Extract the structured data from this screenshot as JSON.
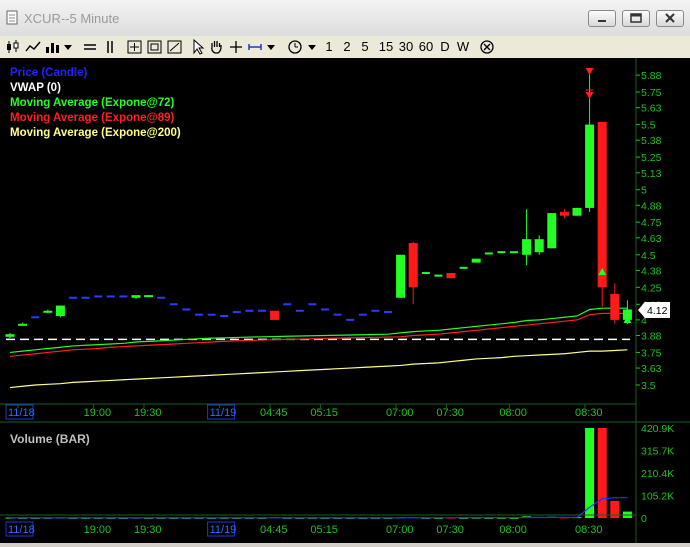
{
  "window": {
    "title": "XCUR--5 Minute"
  },
  "toolbar": {
    "periods": [
      "1",
      "2",
      "5",
      "15",
      "30",
      "60",
      "D",
      "W"
    ]
  },
  "price_panel": {
    "legend": [
      {
        "label": "Price (Candle)",
        "color": "#2222ff"
      },
      {
        "label": "VWAP (0)",
        "color": "#ffffff"
      },
      {
        "label": "Moving Average (Expone@72)",
        "color": "#22ff22"
      },
      {
        "label": "Moving Average (Expone@89)",
        "color": "#ff2020"
      },
      {
        "label": "Moving Average (Expone@200)",
        "color": "#ffff88"
      }
    ],
    "y_ticks": [
      "5.88",
      "5.75",
      "5.63",
      "5.5",
      "5.38",
      "5.25",
      "5.13",
      "5",
      "4.88",
      "4.75",
      "4.63",
      "4.5",
      "4.38",
      "4.25",
      "4.12",
      "4",
      "3.88",
      "3.75",
      "3.63",
      "3.5"
    ],
    "last_price": "4.12"
  },
  "volume_panel": {
    "title": "Volume (BAR)",
    "y_ticks": [
      "420.9K",
      "315.7K",
      "210.4K",
      "105.2K",
      "0"
    ]
  },
  "x_axis": {
    "labels": [
      "11/18",
      "19:00",
      "19:30",
      "11/19",
      "04:45",
      "05:15",
      "07:00",
      "07:30",
      "08:00",
      "08:30"
    ]
  },
  "chart_data": {
    "type": "candlestick",
    "y_range": [
      3.4,
      5.95
    ],
    "volume_range": [
      0,
      420900
    ],
    "candles": [
      {
        "o": 3.87,
        "h": 3.9,
        "l": 3.86,
        "c": 3.89,
        "v": 2000
      },
      {
        "o": 3.97,
        "h": 3.98,
        "l": 3.96,
        "c": 3.97,
        "v": 1000
      },
      {
        "o": 4.02,
        "h": 4.02,
        "l": 4.02,
        "c": 4.02,
        "v": 1000
      },
      {
        "o": 4.06,
        "h": 4.08,
        "l": 4.05,
        "c": 4.07,
        "v": 1500
      },
      {
        "o": 4.03,
        "h": 4.11,
        "l": 4.02,
        "c": 4.11,
        "v": 3000
      },
      {
        "o": 4.17,
        "h": 4.17,
        "l": 4.17,
        "c": 4.17,
        "v": 1000
      },
      {
        "o": 4.17,
        "h": 4.17,
        "l": 4.17,
        "c": 4.17,
        "v": 1000
      },
      {
        "o": 4.18,
        "h": 4.18,
        "l": 4.18,
        "c": 4.18,
        "v": 1000
      },
      {
        "o": 4.18,
        "h": 4.18,
        "l": 4.18,
        "c": 4.18,
        "v": 1000
      },
      {
        "o": 4.18,
        "h": 4.18,
        "l": 4.18,
        "c": 4.18,
        "v": 1000
      },
      {
        "o": 4.17,
        "h": 4.19,
        "l": 4.16,
        "c": 4.19,
        "v": 2000
      },
      {
        "o": 4.18,
        "h": 4.19,
        "l": 4.18,
        "c": 4.19,
        "v": 1000
      },
      {
        "o": 4.17,
        "h": 4.17,
        "l": 4.17,
        "c": 4.17,
        "v": 1000
      },
      {
        "o": 4.12,
        "h": 4.12,
        "l": 4.12,
        "c": 4.12,
        "v": 1000
      },
      {
        "o": 4.08,
        "h": 4.08,
        "l": 4.08,
        "c": 4.08,
        "v": 1000
      },
      {
        "o": 4.04,
        "h": 4.04,
        "l": 4.04,
        "c": 4.04,
        "v": 1000
      },
      {
        "o": 4.04,
        "h": 4.04,
        "l": 4.04,
        "c": 4.04,
        "v": 1000
      },
      {
        "o": 4.03,
        "h": 4.03,
        "l": 4.03,
        "c": 4.03,
        "v": 1000
      },
      {
        "o": 4.06,
        "h": 4.06,
        "l": 4.06,
        "c": 4.06,
        "v": 1000
      },
      {
        "o": 4.07,
        "h": 4.07,
        "l": 4.07,
        "c": 4.07,
        "v": 1000
      },
      {
        "o": 4.07,
        "h": 4.07,
        "l": 4.07,
        "c": 4.07,
        "v": 1000
      },
      {
        "o": 4.07,
        "h": 4.07,
        "l": 4.0,
        "c": 4.0,
        "v": 5000
      },
      {
        "o": 4.12,
        "h": 4.12,
        "l": 4.12,
        "c": 4.12,
        "v": 1000
      },
      {
        "o": 4.07,
        "h": 4.07,
        "l": 4.07,
        "c": 4.07,
        "v": 1000
      },
      {
        "o": 4.12,
        "h": 4.12,
        "l": 4.12,
        "c": 4.12,
        "v": 1000
      },
      {
        "o": 4.08,
        "h": 4.08,
        "l": 4.08,
        "c": 4.08,
        "v": 1000
      },
      {
        "o": 4.04,
        "h": 4.04,
        "l": 4.04,
        "c": 4.04,
        "v": 1000
      },
      {
        "o": 4.0,
        "h": 4.0,
        "l": 4.0,
        "c": 4.0,
        "v": 1000
      },
      {
        "o": 4.04,
        "h": 4.04,
        "l": 4.04,
        "c": 4.04,
        "v": 1000
      },
      {
        "o": 4.07,
        "h": 4.07,
        "l": 4.07,
        "c": 4.07,
        "v": 1000
      },
      {
        "o": 4.06,
        "h": 4.06,
        "l": 4.06,
        "c": 4.06,
        "v": 1000
      },
      {
        "o": 4.17,
        "h": 4.5,
        "l": 4.17,
        "c": 4.5,
        "v": 3000
      },
      {
        "o": 4.59,
        "h": 4.6,
        "l": 4.12,
        "c": 4.25,
        "v": 4000
      },
      {
        "o": 4.36,
        "h": 4.36,
        "l": 4.36,
        "c": 4.36,
        "v": 1000
      },
      {
        "o": 4.34,
        "h": 4.34,
        "l": 4.34,
        "c": 4.34,
        "v": 1000
      },
      {
        "o": 4.36,
        "h": 4.36,
        "l": 4.32,
        "c": 4.32,
        "v": 2000
      },
      {
        "o": 4.4,
        "h": 4.4,
        "l": 4.4,
        "c": 4.4,
        "v": 1000
      },
      {
        "o": 4.44,
        "h": 4.47,
        "l": 4.44,
        "c": 4.47,
        "v": 1500
      },
      {
        "o": 4.51,
        "h": 4.51,
        "l": 4.51,
        "c": 4.51,
        "v": 1000
      },
      {
        "o": 4.52,
        "h": 4.52,
        "l": 4.52,
        "c": 4.52,
        "v": 1000
      },
      {
        "o": 4.52,
        "h": 4.52,
        "l": 4.52,
        "c": 4.52,
        "v": 1000
      },
      {
        "o": 4.5,
        "h": 4.85,
        "l": 4.42,
        "c": 4.62,
        "v": 8000
      },
      {
        "o": 4.52,
        "h": 4.65,
        "l": 4.5,
        "c": 4.62,
        "v": 5000
      },
      {
        "o": 4.55,
        "h": 4.82,
        "l": 4.55,
        "c": 4.82,
        "v": 6000
      },
      {
        "o": 4.83,
        "h": 4.85,
        "l": 4.78,
        "c": 4.8,
        "v": 3000
      },
      {
        "o": 4.8,
        "h": 4.86,
        "l": 4.8,
        "c": 4.86,
        "v": 4000
      },
      {
        "o": 4.86,
        "h": 5.92,
        "l": 4.83,
        "c": 5.5,
        "v": 420900
      },
      {
        "o": 5.52,
        "h": 5.52,
        "l": 4.1,
        "c": 4.25,
        "v": 420900
      },
      {
        "o": 4.2,
        "h": 4.28,
        "l": 3.97,
        "c": 4.0,
        "v": 80000
      },
      {
        "o": 4.0,
        "h": 4.15,
        "l": 3.97,
        "c": 4.08,
        "v": 30000
      }
    ],
    "vwap": [
      3.85,
      3.85,
      3.85,
      3.85,
      3.85,
      3.85,
      3.85,
      3.85,
      3.85,
      3.85,
      3.85,
      3.85,
      3.85,
      3.85,
      3.85,
      3.85,
      3.85,
      3.85,
      3.85,
      3.85,
      3.85,
      3.85,
      3.85,
      3.85,
      3.85,
      3.85,
      3.85,
      3.85,
      3.85,
      3.85,
      3.85,
      3.85,
      3.85,
      3.85,
      3.85,
      3.85,
      3.85,
      3.85,
      3.85,
      3.85,
      3.85,
      3.85,
      3.85,
      3.85,
      3.85,
      3.85,
      3.85,
      3.85,
      3.85,
      3.85
    ],
    "ema72": [
      3.75,
      3.76,
      3.77,
      3.78,
      3.79,
      3.8,
      3.805,
      3.81,
      3.815,
      3.82,
      3.83,
      3.835,
      3.84,
      3.845,
      3.85,
      3.855,
      3.86,
      3.862,
      3.865,
      3.868,
      3.87,
      3.872,
      3.874,
      3.876,
      3.878,
      3.88,
      3.882,
      3.884,
      3.886,
      3.888,
      3.89,
      3.9,
      3.91,
      3.915,
      3.92,
      3.93,
      3.94,
      3.95,
      3.96,
      3.97,
      3.98,
      3.995,
      4.0,
      4.01,
      4.02,
      4.03,
      4.08,
      4.09,
      4.09,
      4.09
    ],
    "ema89": [
      3.72,
      3.73,
      3.74,
      3.75,
      3.76,
      3.77,
      3.775,
      3.78,
      3.79,
      3.795,
      3.8,
      3.805,
      3.81,
      3.815,
      3.82,
      3.825,
      3.83,
      3.835,
      3.84,
      3.842,
      3.845,
      3.848,
      3.85,
      3.852,
      3.855,
      3.858,
      3.86,
      3.862,
      3.864,
      3.866,
      3.868,
      3.87,
      3.88,
      3.885,
      3.89,
      3.9,
      3.91,
      3.92,
      3.93,
      3.94,
      3.95,
      3.96,
      3.97,
      3.98,
      3.99,
      4.0,
      4.04,
      4.05,
      4.05,
      4.05
    ],
    "ema200": [
      3.48,
      3.49,
      3.5,
      3.505,
      3.51,
      3.52,
      3.525,
      3.53,
      3.535,
      3.54,
      3.545,
      3.55,
      3.555,
      3.56,
      3.565,
      3.57,
      3.575,
      3.58,
      3.585,
      3.59,
      3.595,
      3.6,
      3.605,
      3.61,
      3.615,
      3.62,
      3.625,
      3.63,
      3.635,
      3.64,
      3.645,
      3.65,
      3.66,
      3.665,
      3.67,
      3.68,
      3.69,
      3.7,
      3.705,
      3.71,
      3.72,
      3.725,
      3.73,
      3.735,
      3.74,
      3.75,
      3.76,
      3.76,
      3.765,
      3.77
    ],
    "volume_avg": [
      1000,
      1000,
      1000,
      1000,
      1000,
      1000,
      1000,
      1000,
      1000,
      1000,
      1000,
      1000,
      1000,
      1000,
      1000,
      1000,
      1000,
      1000,
      1000,
      1000,
      1000,
      1000,
      1000,
      1000,
      1000,
      1000,
      1000,
      1000,
      1000,
      1000,
      1000,
      1000,
      1200,
      1300,
      1400,
      1500,
      1600,
      1700,
      1800,
      1900,
      2000,
      2200,
      2400,
      2600,
      2800,
      3000,
      50000,
      90000,
      95000,
      95000
    ]
  }
}
